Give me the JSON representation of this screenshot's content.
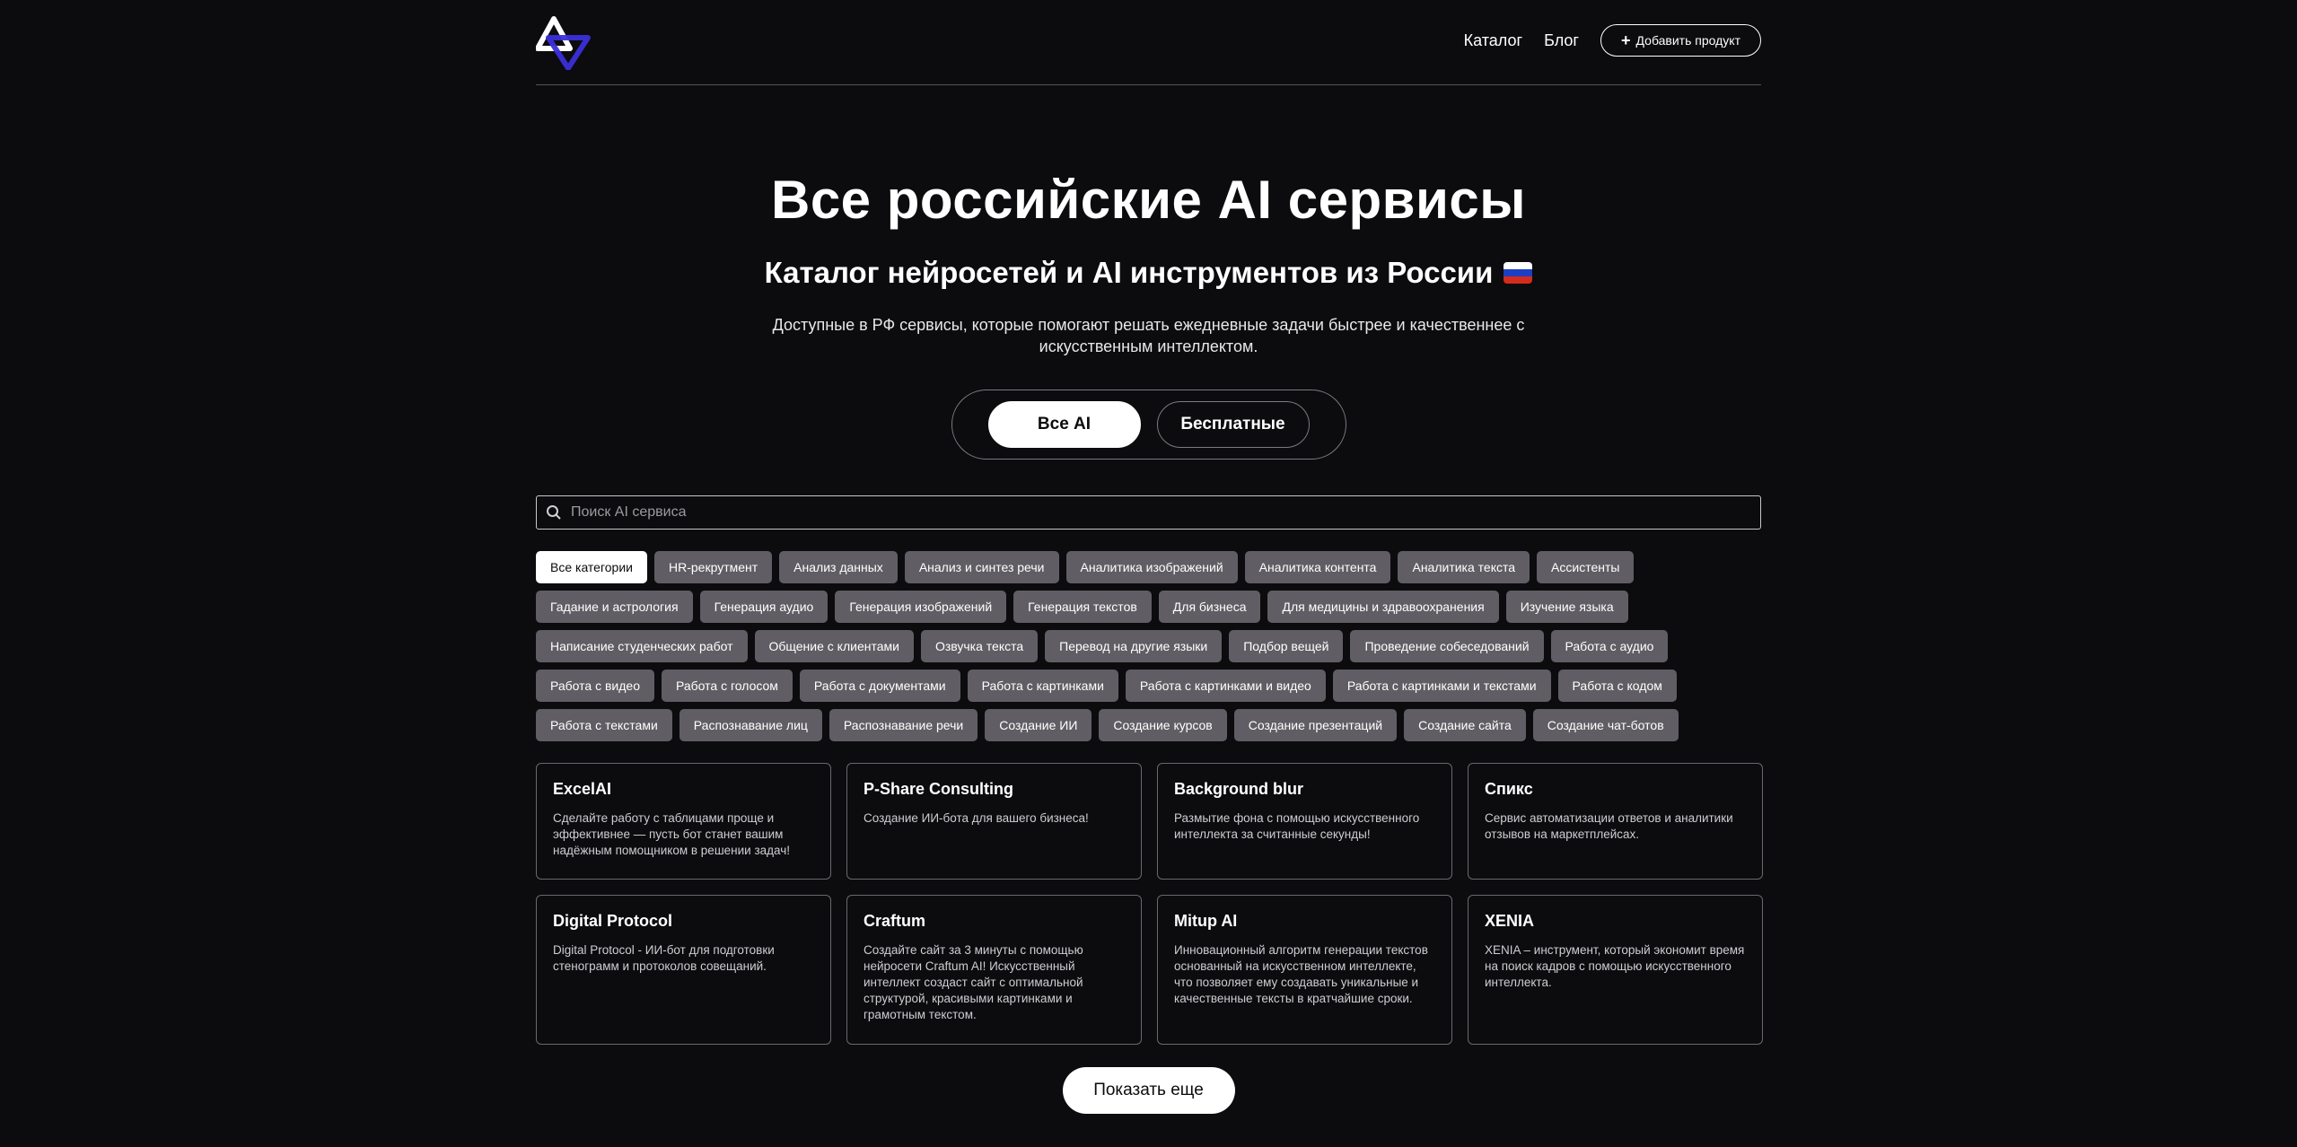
{
  "header": {
    "logo": "triangle-logo",
    "nav": [
      "Каталог",
      "Блог"
    ],
    "add_button": "Добавить продукт"
  },
  "hero": {
    "title": "Все российские AI сервисы",
    "subtitle": "Каталог нейросетей и AI инструментов из России",
    "description": "Доступные в РФ сервисы, которые помогают решать ежедневные задачи быстрее и качественнее с искусственным интеллектом.",
    "flag_colors": [
      "#ffffff",
      "#1c3fc4",
      "#d52b1e"
    ]
  },
  "toggle": {
    "all": "Все AI",
    "free": "Бесплатные"
  },
  "search": {
    "placeholder": "Поиск AI сервиса"
  },
  "categories": [
    "Все категории",
    "HR-рекрутмент",
    "Анализ данных",
    "Анализ и синтез речи",
    "Аналитика изображений",
    "Аналитика контента",
    "Аналитика текста",
    "Ассистенты",
    "Гадание и астрология",
    "Генерация аудио",
    "Генерация изображений",
    "Генерация текстов",
    "Для бизнеса",
    "Для медицины и здравоохранения",
    "Изучение языка",
    "Написание студенческих работ",
    "Общение с клиентами",
    "Озвучка текста",
    "Перевод на другие языки",
    "Подбор вещей",
    "Проведение собеседований",
    "Работа с аудио",
    "Работа с видео",
    "Работа с голосом",
    "Работа с документами",
    "Работа с картинками",
    "Работа с картинками и видео",
    "Работа с картинками и текстами",
    "Работа с кодом",
    "Работа с текстами",
    "Распознавание лиц",
    "Распознавание речи",
    "Создание ИИ",
    "Создание курсов",
    "Создание презентаций",
    "Создание сайта",
    "Создание чат-ботов"
  ],
  "cards_row1": [
    {
      "title": "ExcelAI",
      "desc": "Сделайте работу с таблицами проще и эффективнее — пусть бот станет вашим надёжным помощником в решении задач!"
    },
    {
      "title": "P-Share Consulting",
      "desc": "Создание ИИ-бота для вашего бизнеса!"
    },
    {
      "title": "Background blur",
      "desc": "Размытие фона с помощью искусственного интеллекта за считанные секунды!"
    },
    {
      "title": "Спикс",
      "desc": "Сервис автоматизации ответов и аналитики отзывов на маркетплейсах."
    }
  ],
  "cards_row2": [
    {
      "title": "Digital Protocol",
      "desc": "Digital Protocol - ИИ-бот для подготовки стенограмм и протоколов совещаний."
    },
    {
      "title": "Craftum",
      "desc": "Создайте сайт за 3 минуты с помощью нейросети Craftum AI! Искусственный интеллект создаст сайт с оптимальной структурой, красивыми картинками и грамотным текстом."
    },
    {
      "title": "Mitup AI",
      "desc": "Инновационный алгоритм генерации текстов основанный на искусственном интеллекте, что позволяет ему создавать уникальные и качественные тексты в кратчайшие сроки."
    },
    {
      "title": "XENIA",
      "desc": "XENIA – инструмент, который экономит время на поиск кадров с помощью искусственного интеллекта."
    }
  ],
  "more_button": "Показать еще"
}
